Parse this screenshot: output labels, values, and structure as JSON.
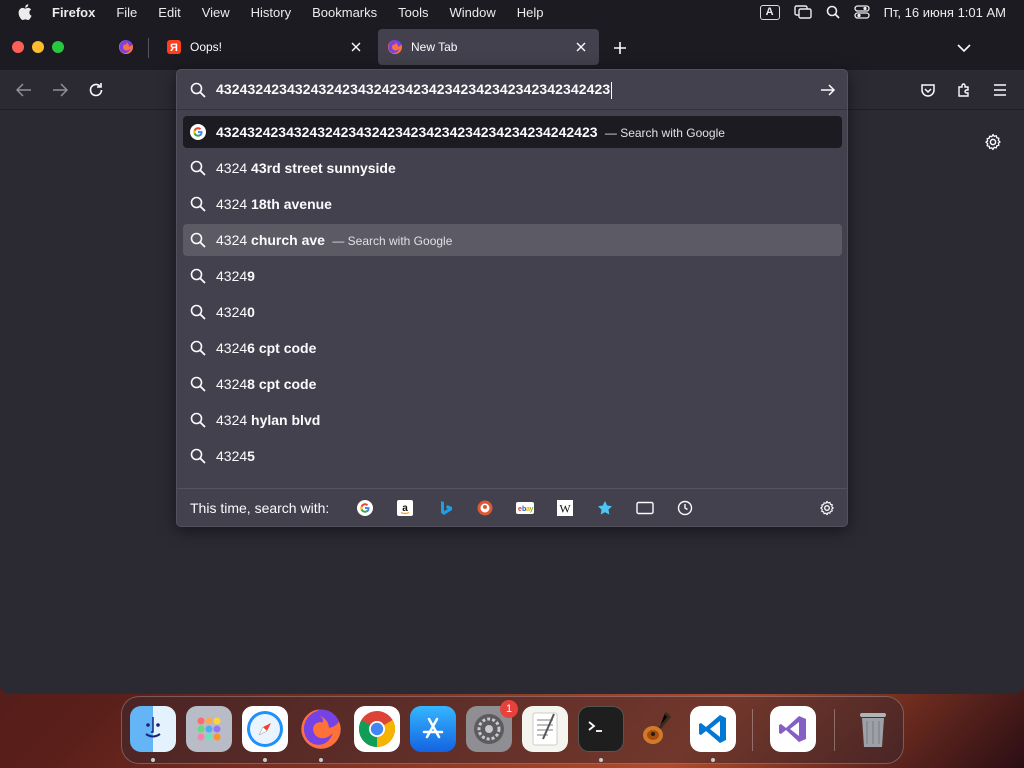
{
  "menubar": {
    "app": "Firefox",
    "items": [
      "File",
      "Edit",
      "View",
      "History",
      "Bookmarks",
      "Tools",
      "Window",
      "Help"
    ],
    "input_indicator": "A",
    "clock": "Пт, 16 июня  1:01 AM"
  },
  "tabs": [
    {
      "title": "Oops!",
      "icon": "yandex-icon"
    },
    {
      "title": "New Tab",
      "icon": "firefox-icon",
      "active": true
    }
  ],
  "urlbar": {
    "value": "43243242343243242343242342342342342342342342342423"
  },
  "results": [
    {
      "typed": "",
      "bold": "4324324234324324234324234234234234234234234242423",
      "action": "Search with Google",
      "icon": "google-icon"
    },
    {
      "typed": "4324",
      "bold": " 43rd street sunnyside",
      "icon": "search-icon"
    },
    {
      "typed": "4324",
      "bold": " 18th avenue",
      "icon": "search-icon"
    },
    {
      "typed": "4324",
      "bold": " church ave",
      "action": "Search with Google",
      "icon": "search-icon"
    },
    {
      "typed": "4324",
      "bold": "9",
      "icon": "search-icon"
    },
    {
      "typed": "4324",
      "bold": "0",
      "icon": "search-icon"
    },
    {
      "typed": "4324",
      "bold": "6 cpt code",
      "icon": "search-icon"
    },
    {
      "typed": "4324",
      "bold": "8 cpt code",
      "icon": "search-icon"
    },
    {
      "typed": "4324",
      "bold": " hylan blvd",
      "icon": "search-icon"
    },
    {
      "typed": "4324",
      "bold": "5",
      "icon": "search-icon"
    }
  ],
  "oneoff": {
    "label": "This time, search with:",
    "engines": [
      "google-icon",
      "amazon-icon",
      "bing-icon",
      "duckduckgo-icon",
      "ebay-icon",
      "wikipedia-icon",
      "bookmarks-icon",
      "tabs-icon",
      "history-icon"
    ]
  },
  "dock": {
    "apps": [
      "finder-icon",
      "launchpad-icon",
      "safari-icon",
      "firefox-icon",
      "chrome-icon",
      "app-store-icon",
      "system-preferences-icon",
      "textedit-icon",
      "terminal-icon",
      "garageband-icon",
      "vscode-icon",
      "visual-studio-icon",
      "trash-icon"
    ],
    "badge": "1"
  }
}
